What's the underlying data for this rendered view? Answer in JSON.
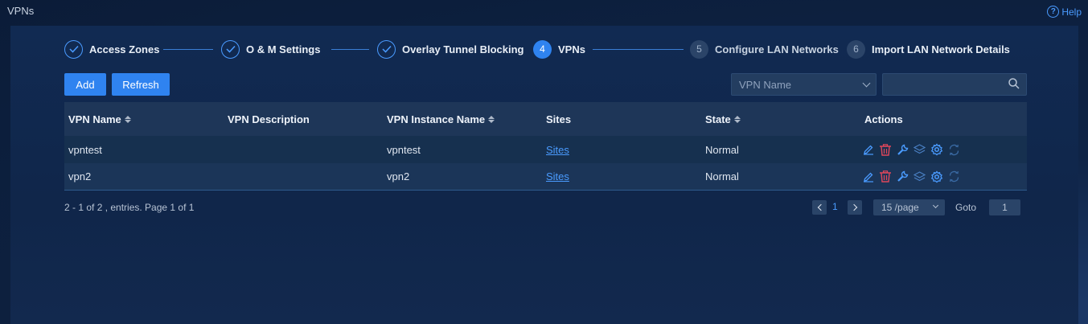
{
  "page": {
    "title": "VPNs",
    "help_label": "Help",
    "help_icon": "?"
  },
  "stepper": {
    "steps": [
      {
        "number": "",
        "label": "Access Zones",
        "state": "done"
      },
      {
        "number": "",
        "label": "O & M Settings",
        "state": "done"
      },
      {
        "number": "",
        "label": "Overlay Tunnel Blocking",
        "state": "done"
      },
      {
        "number": "4",
        "label": "VPNs",
        "state": "active"
      },
      {
        "number": "5",
        "label": "Configure LAN Networks",
        "state": "todo"
      },
      {
        "number": "6",
        "label": "Import LAN Network Details",
        "state": "todo"
      }
    ]
  },
  "toolbar": {
    "add_label": "Add",
    "refresh_label": "Refresh",
    "filter_select_value": "VPN Name",
    "search_value": ""
  },
  "table": {
    "headers": [
      "VPN Name",
      "VPN Description",
      "VPN Instance Name",
      "Sites",
      "State",
      "Actions"
    ],
    "rows": [
      {
        "vpn_name": "vpntest",
        "description": "",
        "instance_name": "vpntest",
        "sites": "Sites",
        "state": "Normal"
      },
      {
        "vpn_name": "vpn2",
        "description": "",
        "instance_name": "vpn2",
        "sites": "Sites",
        "state": "Normal"
      }
    ],
    "action_icons": [
      "edit-icon",
      "delete-icon",
      "wrench-icon",
      "layers-icon",
      "gear-icon",
      "sync-icon"
    ]
  },
  "pagination": {
    "summary": "2 - 1 of 2 , entries. Page 1 of 1",
    "current_page": "1",
    "per_page": "15 /page",
    "goto_label": "Goto",
    "goto_value": "1"
  },
  "colors": {
    "accent": "#2f83f0",
    "link": "#4a9bff",
    "delete": "#e0475b",
    "background": "#0f2446"
  }
}
